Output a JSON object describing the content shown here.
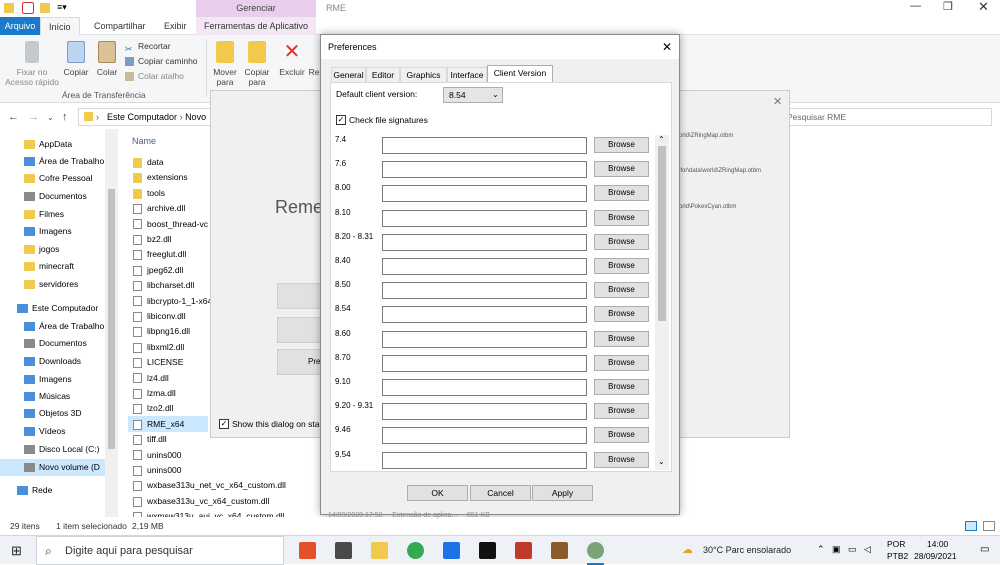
{
  "window": {
    "title": "RME",
    "context_header": "Gerenciar"
  },
  "ribbon": {
    "tabs": [
      "Arquivo",
      "Início",
      "Compartilhar",
      "Exibir",
      "Ferramentas de Aplicativo"
    ],
    "buttons": {
      "fixar": "Fixar no\nAcesso rápido",
      "copiar": "Copiar",
      "colar": "Colar",
      "recortar": "Recortar",
      "copiar_caminho": "Copiar caminho",
      "colar_atalho": "Colar atalho",
      "mover": "Mover\npara",
      "copiar_para": "Copiar\npara",
      "excluir": "Excluir",
      "re": "Re"
    },
    "group_label": "Área de Transferência"
  },
  "address": {
    "path": [
      "Este Computador",
      "Novo"
    ],
    "search_placeholder": "Pesquisar RME"
  },
  "nav": {
    "items": [
      {
        "label": "AppData",
        "icon": "folder-icon"
      },
      {
        "label": "Área de Trabalho",
        "icon": "desktop-icon"
      },
      {
        "label": "Cofre Pessoal",
        "icon": "vault-icon"
      },
      {
        "label": "Documentos",
        "icon": "documents-icon"
      },
      {
        "label": "Filmes",
        "icon": "folder-icon"
      },
      {
        "label": "Imagens",
        "icon": "pictures-icon"
      },
      {
        "label": "jogos",
        "icon": "folder-icon"
      },
      {
        "label": "minecraft",
        "icon": "folder-icon"
      },
      {
        "label": "servidores",
        "icon": "folder-icon"
      },
      {
        "label": "Este Computador",
        "icon": "computer-icon"
      },
      {
        "label": "Área de Trabalho",
        "icon": "desktop-icon"
      },
      {
        "label": "Documentos",
        "icon": "documents-icon"
      },
      {
        "label": "Downloads",
        "icon": "downloads-icon"
      },
      {
        "label": "Imagens",
        "icon": "pictures-icon"
      },
      {
        "label": "Músicas",
        "icon": "music-icon"
      },
      {
        "label": "Objetos 3D",
        "icon": "objects3d-icon"
      },
      {
        "label": "Vídeos",
        "icon": "videos-icon"
      },
      {
        "label": "Disco Local (C:)",
        "icon": "drive-icon"
      },
      {
        "label": "Novo volume (D",
        "icon": "drive-icon"
      },
      {
        "label": "Rede",
        "icon": "network-icon"
      }
    ]
  },
  "files": {
    "column_name": "Name",
    "items": [
      "data",
      "extensions",
      "tools",
      "archive.dll",
      "boost_thread-vc",
      "bz2.dll",
      "freeglut.dll",
      "jpeg62.dll",
      "libcharset.dll",
      "libcrypto-1_1-x64",
      "libiconv.dll",
      "libpng16.dll",
      "libxml2.dll",
      "LICENSE",
      "lz4.dll",
      "lzma.dll",
      "lzo2.dll",
      "RME_x64",
      "tiff.dll",
      "unins000",
      "unins000",
      "wxbase313u_net_vc_x64_custom.dll",
      "wxbase313u_vc_x64_custom.dll",
      "wxmsw313u_aui_vc_x64_custom.dll"
    ],
    "partial_row": "14/09/2020 17:50     Extensão de aplica...     651 KB"
  },
  "status": {
    "count": "29 itens",
    "selected": "1 item selecionado",
    "size": "2,19 MB"
  },
  "rme_window": {
    "title_partial": "Reme",
    "checkbox_label": "Show this dialog on sta",
    "button_partial": "Pre",
    "recent": [
      "orld\\ZRingMap.otbm",
      "ifor\\data\\world\\ZRingMap.otbm",
      "orld\\PokexCyan.otbm"
    ]
  },
  "dialog": {
    "title": "Preferences",
    "tabs": [
      "General",
      "Editor",
      "Graphics",
      "Interface",
      "Client Version"
    ],
    "default_client_label": "Default client version:",
    "default_client_value": "8.54",
    "check_file_signatures": "Check file signatures",
    "browse_label": "Browse",
    "versions": [
      "7.4",
      "7.6",
      "8.00",
      "8.10",
      "8.20 - 8.31",
      "8.40",
      "8.50",
      "8.54",
      "8.60",
      "8.70",
      "9.10",
      "9.20 - 9.31",
      "9.46",
      "9.54"
    ],
    "ok": "OK",
    "cancel": "Cancel",
    "apply": "Apply"
  },
  "taskbar": {
    "search_placeholder": "Digite aqui para pesquisar",
    "weather": "30°C  Parc ensolarado",
    "lang": "POR",
    "layout": "PTB2",
    "time": "14:00",
    "date": "28/09/2021"
  }
}
